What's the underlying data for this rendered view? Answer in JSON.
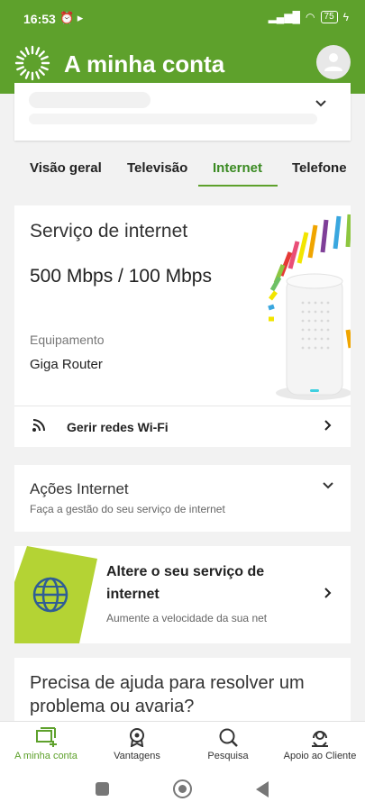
{
  "status_bar": {
    "time": "16:53",
    "battery": "75"
  },
  "header": {
    "title": "A minha conta"
  },
  "tabs": [
    {
      "label": "Visão geral"
    },
    {
      "label": "Televisão"
    },
    {
      "label": "Internet"
    },
    {
      "label": "Telefone"
    }
  ],
  "active_tab": "Internet",
  "service": {
    "title": "Serviço de internet",
    "speed": "500 Mbps / 100 Mbps",
    "equipment_label": "Equipamento",
    "equipment_value": "Giga Router",
    "wifi_label": "Gerir redes Wi-Fi"
  },
  "actions": {
    "title": "Ações Internet",
    "subtitle": "Faça a gestão do seu serviço de internet"
  },
  "promo": {
    "title": "Altere o seu serviço de internet",
    "subtitle": "Aumente a velocidade da sua net"
  },
  "help": {
    "title": "Precisa de ajuda para resolver um problema ou avaria?"
  },
  "bottom_nav": [
    {
      "label": "A minha conta",
      "icon": "account-icon"
    },
    {
      "label": "Vantagens",
      "icon": "medal-icon"
    },
    {
      "label": "Pesquisa",
      "icon": "search-icon"
    },
    {
      "label": "Apoio ao Cliente",
      "icon": "support-icon"
    }
  ],
  "colors": {
    "brand_green": "#5ea12c",
    "lime": "#b4d334",
    "globe_blue": "#2f5d95"
  }
}
